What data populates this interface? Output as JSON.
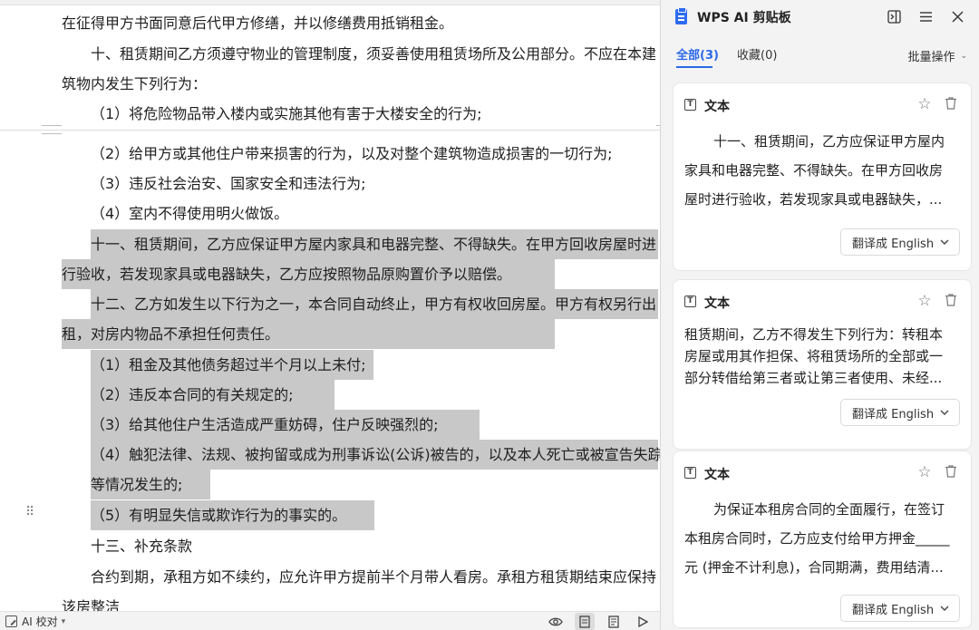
{
  "document": {
    "lines": [
      "在征得甲方书面同意后代甲方修缮，并以修缮费用抵销租金。",
      "十、租赁期间乙方须遵守物业的管理制度，须妥善使用租赁场所及公用部分。不应在本建",
      "筑物内发生下列行为：",
      "（1）将危险物品带入楼内或实施其他有害于大楼安全的行为;",
      "（2）给甲方或其他住户带来损害的行为，以及对整个建筑物造成损害的一切行为;",
      "（3）违反社会治安、国家安全和违法行为;",
      "（4）室内不得使用明火做饭。",
      "十一、租赁期间，乙方应保证甲方屋内家具和电器完整、不得缺失。在甲方回收房屋时进",
      "行验收，若发现家具或电器缺失，乙方应按照物品原购置价予以赔偿。",
      "十二、乙方如发生以下行为之一，本合同自动终止，甲方有权收回房屋。甲方有权另行出",
      "租，对房内物品不承担任何责任。",
      "（1）租金及其他债务超过半个月以上未付;",
      "（2）违反本合同的有关规定的;",
      "（3）给其他住户生活造成严重妨碍，住户反映强烈的;",
      "（4）触犯法律、法规、被拘留或成为刑事诉讼(公诉)被告的，以及本人死亡或被宣告失踪",
      "等情况发生的;",
      "（5）有明显失信或欺诈行为的事实的。",
      "十三、补充条款",
      "合约到期，承租方如不续约，应允许甲方提前半个月带人看房。承租方租赁期结束应保持",
      "该房整洁"
    ]
  },
  "status_bar": {
    "ai_check_label": "AI 校对",
    "icons": [
      "eye-icon",
      "page-view-icon",
      "web-view-icon",
      "play-icon"
    ]
  },
  "panel": {
    "title": "WPS AI 剪贴板",
    "tabs": [
      {
        "label": "全部(3)",
        "active": true
      },
      {
        "label": "收藏(0)",
        "active": false
      }
    ],
    "batch_label": "批量操作",
    "cards": [
      {
        "type": "文本",
        "lines": [
          "十一、租赁期间，乙方应保证甲方屋内",
          "家具和电器完整、不得缺失。在甲方回收房",
          "屋时进行验收，若发现家具或电器缺失，..."
        ],
        "translate_label": "翻译成 English"
      },
      {
        "type": "文本",
        "lines": [
          "租赁期间，乙方不得发生下列行为：转租本",
          "房屋或用其作担保、将租赁场所的全部或一",
          "部分转借给第三者或让第三者使用、未经..."
        ],
        "translate_label": "翻译成 English"
      },
      {
        "type": "文本",
        "lines": [
          "为保证本租房合同的全面履行，在签订",
          "本租房合同时，乙方应支付给甲方押金_____",
          "元 (押金不计利息)，合同期满，费用结清..."
        ],
        "translate_label": "翻译成 English"
      }
    ]
  },
  "colors": {
    "accent": "#2a67e8",
    "selection": "#c8c8c8"
  }
}
